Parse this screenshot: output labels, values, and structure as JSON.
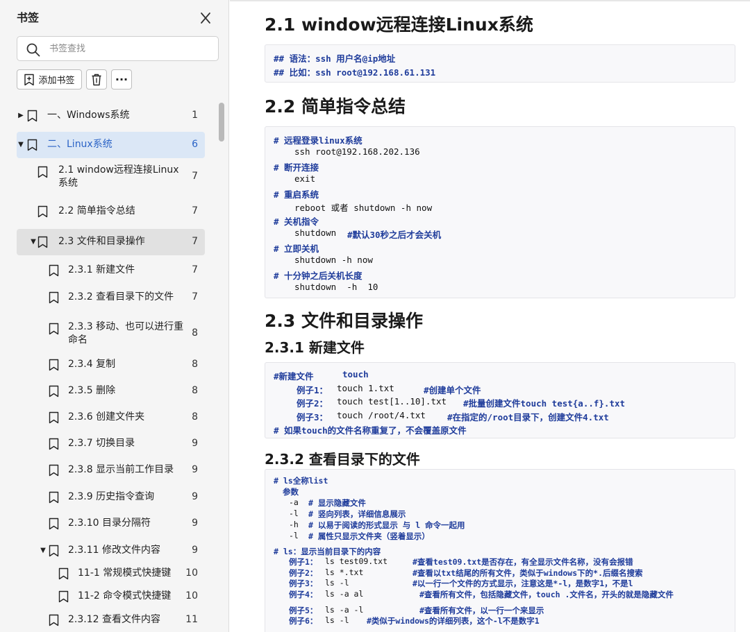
{
  "sidebar": {
    "title": "书签",
    "search_placeholder": "书签查找",
    "add_bookmark_label": "添加书签",
    "more_label": "···",
    "items": [
      {
        "label": "一、Windows系统",
        "page": "1"
      },
      {
        "label": "二、Linux系统",
        "page": "6"
      },
      {
        "label": "2.1 window远程连接Linux",
        "label2": "系统",
        "page": "7"
      },
      {
        "label": "2.2 简单指令总结",
        "page": "7"
      },
      {
        "label": "2.3 文件和目录操作",
        "page": "7"
      },
      {
        "label": "2.3.1 新建文件",
        "page": "7"
      },
      {
        "label": "2.3.2 查看目录下的文件",
        "page": "7"
      },
      {
        "label": "2.3.3 移动、也可以进行重",
        "label2": "命名",
        "page": "8"
      },
      {
        "label": "2.3.4 复制",
        "page": "8"
      },
      {
        "label": "2.3.5 删除",
        "page": "8"
      },
      {
        "label": "2.3.6 创建文件夹",
        "page": "8"
      },
      {
        "label": "2.3.7 切换目录",
        "page": "9"
      },
      {
        "label": "2.3.8 显示当前工作目录",
        "page": "9"
      },
      {
        "label": "2.3.9 历史指令查询",
        "page": "9"
      },
      {
        "label": "2.3.10 目录分隔符",
        "page": "9"
      },
      {
        "label": "2.3.11 修改文件内容",
        "page": "9"
      },
      {
        "label": "11-1 常规模式快捷键",
        "page": "10"
      },
      {
        "label": "11-2 命令模式快捷键",
        "page": "10"
      },
      {
        "label": "2.3.12 查看文件内容",
        "page": "11"
      }
    ]
  },
  "content": {
    "h_2_1": "2.1 window远程连接Linux系统",
    "code1": [
      "## 语法：ssh 用户名@ip地址",
      "## 比如：ssh root@192.168.61.131"
    ],
    "h_2_2": "2.2 简单指令总结",
    "code2": [
      "# 远程登录linux系统",
      "ssh root@192.168.202.136",
      "# 断开连接",
      "exit",
      "# 重启系统",
      "reboot 或者 shutdown -h now",
      "# 关机指令",
      "shutdown ",
      "#默认30秒之后才会关机",
      "# 立即关机",
      "shutdown -h now",
      "# 十分钟之后关机长度",
      "shutdown  -h  10"
    ],
    "h_2_3": "2.3 文件和目录操作",
    "h_2_3_1": "2.3.1 新建文件",
    "code3": {
      "l1a": "#新建文件",
      "l1b": "touch",
      "l2a": "例子1：",
      "l2b": "touch 1.txt",
      "l2c": "#创建单个文件",
      "l3a": "例子2：",
      "l3b": "touch test[1..10].txt",
      "l3c": "#批量创建文件touch test{a..f}.txt",
      "l4a": "例子3：",
      "l4b": "touch /root/4.txt",
      "l4c": "#在指定的/root目录下，创建文件4.txt",
      "l5": "# 如果touch的文件名称重复了，不会覆盖原文件"
    },
    "h_2_3_2": "2.3.2 查看目录下的文件",
    "code4": {
      "l1": "# ls全称list",
      "l2": "参数",
      "p1a": "-a",
      "p1b": "# 显示隐藏文件",
      "p2a": "-l",
      "p2b": "# 竖向列表，详细信息展示",
      "p3a": "-h",
      "p3b": "# 以易于阅读的形式显示 与 l 命令一起用",
      "p4a": "-l",
      "p4b": "# 属性只显示文件夹（竖着显示）",
      "l7": "# ls：显示当前目录下的内容",
      "e1a": "例子1：",
      "e1b": "ls test09.txt",
      "e1c": "#查看test09.txt是否存在，有全显示文件名称，没有会报错",
      "e2a": "例子2：",
      "e2b": "ls *.txt",
      "e2c": "#查看以txt结尾的所有文件，类似于windows下的*.后缀名搜索",
      "e3a": "例子3：",
      "e3b": "ls -l",
      "e3c": "#以一行一个文件的方式显示，注意这是*-l，是数字1，不是l",
      "e4a": "例子4：",
      "e4b": "ls -a al",
      "e4c": "#查看所有文件，包括隐藏文件，touch .文件名，开头的就是隐藏文件",
      "e5a": "例子5：",
      "e5b": "ls -a -l",
      "e5c": "#查看所有文件，以一行一个来显示",
      "e6a": "例子6：",
      "e6b": "ls -l",
      "e6c": "#类似于windows的详细列表，这个-l不是数字1"
    }
  },
  "colors": {
    "accent": "#2b63c6",
    "selected_bg": "#dbe7f6",
    "comment": "#1f3c9b"
  }
}
